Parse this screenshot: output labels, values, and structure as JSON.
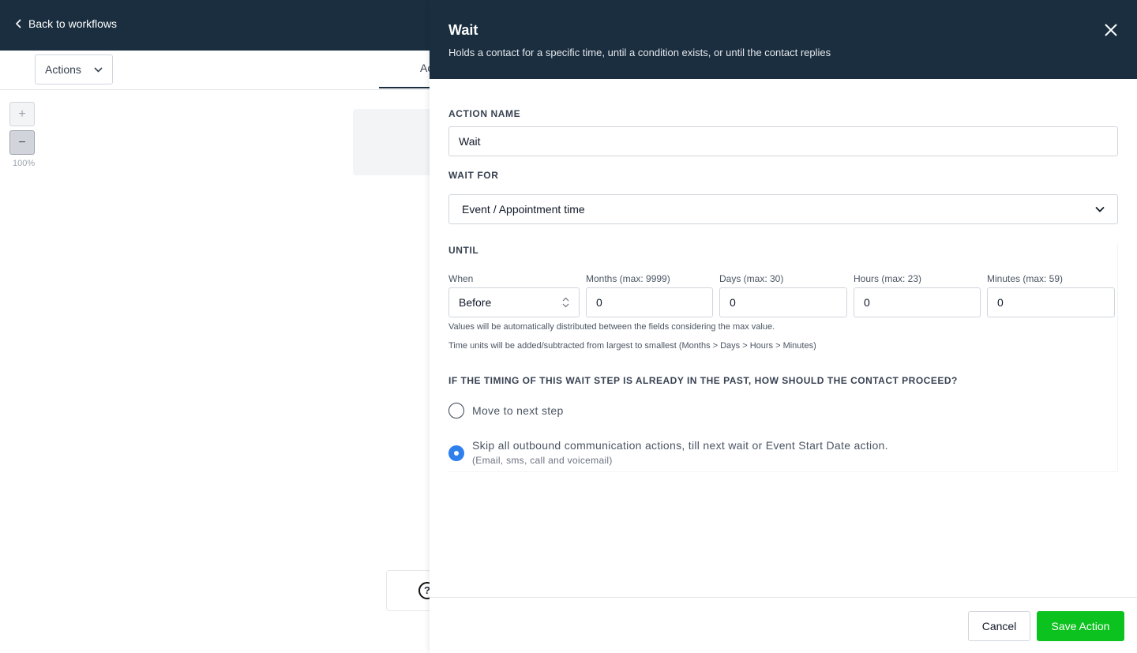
{
  "workflow": {
    "back_label": "Back to workflows",
    "actions_dropdown": "Actions",
    "tab_partial": "Ac",
    "zoom_in": "+",
    "zoom_out": "−",
    "zoom_level": "100%",
    "help_icon": "?"
  },
  "drawer": {
    "title": "Wait",
    "subtitle": "Holds a contact for a specific time, until a condition exists, or until the contact replies",
    "action_name_label": "ACTION NAME",
    "action_name_value": "Wait",
    "wait_for_label": "WAIT FOR",
    "wait_for_value": "Event / Appointment time",
    "until_label": "UNTIL",
    "fields": {
      "when_label": "When",
      "when_value": "Before",
      "months_label": "Months (max: 9999)",
      "months_value": "0",
      "days_label": "Days (max: 30)",
      "days_value": "0",
      "hours_label": "Hours (max: 23)",
      "hours_value": "0",
      "minutes_label": "Minutes (max: 59)",
      "minutes_value": "0"
    },
    "hint_1": "Values will be automatically distributed between the fields considering the max value.",
    "hint_2": "Time units will be added/subtracted from largest to smallest (Months > Days > Hours > Minutes)",
    "question": "IF THE TIMING OF THIS WAIT STEP IS ALREADY IN THE PAST, HOW SHOULD THE CONTACT PROCEED?",
    "options": [
      {
        "label": "Move to next step",
        "sub": "",
        "checked": false
      },
      {
        "label": "Skip all outbound communication actions, till next wait or Event Start Date action.",
        "sub": "(Email, sms, call and voicemail)",
        "checked": true
      }
    ],
    "cancel_label": "Cancel",
    "save_label": "Save Action"
  },
  "colors": {
    "header_bg": "#1a2e3f",
    "save_green": "#0cc21e",
    "radio_blue": "#2f80ed"
  }
}
